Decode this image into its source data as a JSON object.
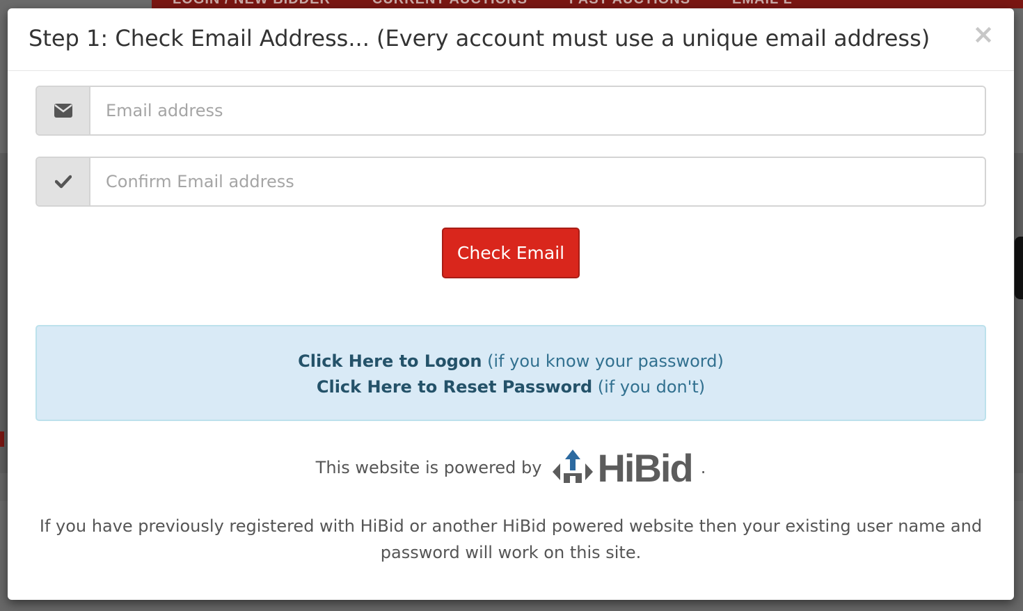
{
  "background": {
    "nav_items": [
      "LOGIN / NEW BIDDER",
      "CURRENT AUCTIONS",
      "PAST AUCTIONS",
      "EMAIL L"
    ]
  },
  "modal": {
    "title": "Step 1: Check Email Address... (Every account must use a unique email address)",
    "close_label": "×",
    "email_input": {
      "placeholder": "Email address",
      "value": "",
      "icon": "envelope-icon"
    },
    "confirm_input": {
      "placeholder": "Confirm Email address",
      "value": "",
      "icon": "check-icon"
    },
    "check_button_label": "Check Email",
    "info": {
      "logon_link": "Click Here to Logon",
      "logon_hint": " (if you know your password)",
      "reset_link": "Click Here to Reset Password",
      "reset_hint": " (if you don't)"
    },
    "powered_by": {
      "text": "This website is powered by",
      "logo_text": "HiBid",
      "suffix": "."
    },
    "footer_note": "If you have previously registered with HiBid or another HiBid powered website then your existing user name and password will work on this site."
  },
  "colors": {
    "button": "#d9261c",
    "info_bg": "#d9eaf6",
    "info_text": "#31708f",
    "link": "#245269",
    "nav": "#7a1612"
  }
}
